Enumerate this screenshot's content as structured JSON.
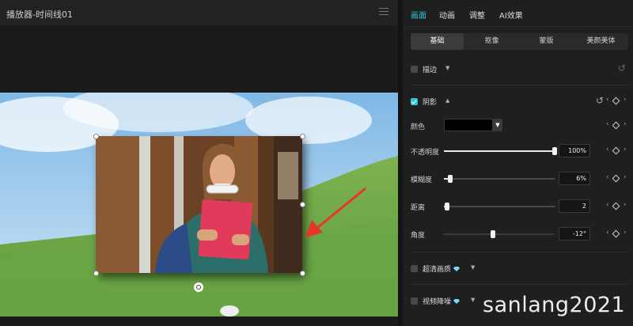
{
  "player": {
    "title": "播放器-时间线01"
  },
  "inspector": {
    "tabs": [
      {
        "label": "画面",
        "active": true
      },
      {
        "label": "动画",
        "active": false
      },
      {
        "label": "调整",
        "active": false
      },
      {
        "label": "AI效果",
        "active": false
      }
    ],
    "subtabs": [
      {
        "label": "基础",
        "active": true
      },
      {
        "label": "抠像",
        "active": false
      },
      {
        "label": "蒙版",
        "active": false
      },
      {
        "label": "美颜美体",
        "active": false
      }
    ],
    "stroke": {
      "label": "描边",
      "checked": false
    },
    "shadow": {
      "label": "阴影",
      "checked": true,
      "color_label": "颜色",
      "color_value": "#000000",
      "params": [
        {
          "label": "不透明度",
          "value": "100%",
          "fraction": 1.0
        },
        {
          "label": "模糊度",
          "value": "6%",
          "fraction": 0.06
        },
        {
          "label": "距离",
          "value": "2",
          "fraction": 0.03
        },
        {
          "label": "角度",
          "value": "-12°",
          "fraction": 0.44
        }
      ]
    },
    "super_resolution": {
      "label": "超清画质",
      "checked": false
    },
    "denoise": {
      "label": "视频降噪",
      "checked": false
    }
  },
  "watermark": "sanlang2021",
  "colors": {
    "accent": "#2ec7d6",
    "panel_bg": "#1f1f1f",
    "player_bg": "#1b1b1b",
    "arrow": "#e8352a"
  }
}
